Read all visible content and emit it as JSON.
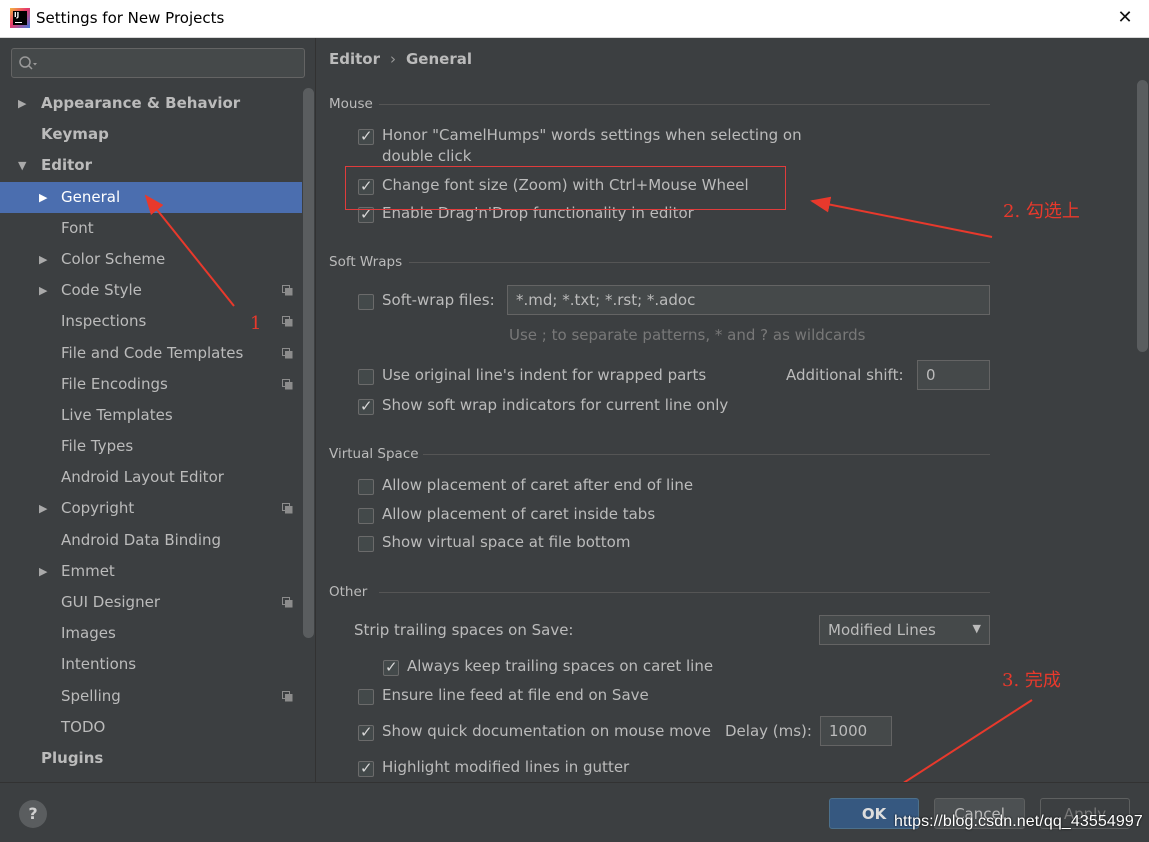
{
  "window": {
    "title": "Settings for New Projects",
    "close_glyph": "✕"
  },
  "sidebar": {
    "search_placeholder": "",
    "items": [
      {
        "label": "Appearance & Behavior",
        "level": 0,
        "arrow": "▶",
        "cfg": false
      },
      {
        "label": "Keymap",
        "level": 0,
        "arrow": "",
        "cfg": false
      },
      {
        "label": "Editor",
        "level": 0,
        "arrow": "▼",
        "cfg": false
      },
      {
        "label": "General",
        "level": 1,
        "arrow": "▶",
        "cfg": false,
        "selected": true
      },
      {
        "label": "Font",
        "level": 1,
        "arrow": "",
        "cfg": false
      },
      {
        "label": "Color Scheme",
        "level": 1,
        "arrow": "▶",
        "cfg": false
      },
      {
        "label": "Code Style",
        "level": 1,
        "arrow": "▶",
        "cfg": true
      },
      {
        "label": "Inspections",
        "level": 1,
        "arrow": "",
        "cfg": true
      },
      {
        "label": "File and Code Templates",
        "level": 1,
        "arrow": "",
        "cfg": true
      },
      {
        "label": "File Encodings",
        "level": 1,
        "arrow": "",
        "cfg": true
      },
      {
        "label": "Live Templates",
        "level": 1,
        "arrow": "",
        "cfg": false
      },
      {
        "label": "File Types",
        "level": 1,
        "arrow": "",
        "cfg": false
      },
      {
        "label": "Android Layout Editor",
        "level": 1,
        "arrow": "",
        "cfg": false
      },
      {
        "label": "Copyright",
        "level": 1,
        "arrow": "▶",
        "cfg": true
      },
      {
        "label": "Android Data Binding",
        "level": 1,
        "arrow": "",
        "cfg": false
      },
      {
        "label": "Emmet",
        "level": 1,
        "arrow": "▶",
        "cfg": false
      },
      {
        "label": "GUI Designer",
        "level": 1,
        "arrow": "",
        "cfg": true
      },
      {
        "label": "Images",
        "level": 1,
        "arrow": "",
        "cfg": false
      },
      {
        "label": "Intentions",
        "level": 1,
        "arrow": "",
        "cfg": false
      },
      {
        "label": "Spelling",
        "level": 1,
        "arrow": "",
        "cfg": true
      },
      {
        "label": "TODO",
        "level": 1,
        "arrow": "",
        "cfg": false
      },
      {
        "label": "Plugins",
        "level": 0,
        "arrow": "",
        "cfg": false
      }
    ]
  },
  "breadcrumb": {
    "parent": "Editor",
    "separator": "›",
    "current": "General"
  },
  "mouse": {
    "title": "Mouse",
    "camel_humps_line1": "Honor \"CamelHumps\" words settings when selecting on",
    "camel_humps_line2": "double click",
    "zoom": "Change font size (Zoom) with Ctrl+Mouse Wheel",
    "dragdrop": "Enable Drag'n'Drop functionality in editor"
  },
  "soft_wraps": {
    "title": "Soft Wraps",
    "files_label": "Soft-wrap files:",
    "files_value": "*.md; *.txt; *.rst; *.adoc",
    "hint": "Use ; to separate patterns, * and ? as wildcards",
    "original_indent": "Use original line's indent for wrapped parts",
    "additional_shift_label": "Additional shift:",
    "additional_shift_value": "0",
    "show_indicators": "Show soft wrap indicators for current line only"
  },
  "virtual_space": {
    "title": "Virtual Space",
    "after_eol": "Allow placement of caret after end of line",
    "inside_tabs": "Allow placement of caret inside tabs",
    "file_bottom": "Show virtual space at file bottom"
  },
  "other": {
    "title": "Other",
    "strip_label": "Strip trailing spaces on Save:",
    "strip_value": "Modified Lines",
    "keep_caret": "Always keep trailing spaces on caret line",
    "line_feed": "Ensure line feed at file end on Save",
    "quick_doc": "Show quick documentation on mouse move",
    "delay_label": "Delay (ms):",
    "delay_value": "1000",
    "highlight_modified": "Highlight modified lines in gutter"
  },
  "annotations": {
    "a1": "1",
    "a2": "2. 勾选上",
    "a3": "3. 完成",
    "color": "#e8392c"
  },
  "footer": {
    "help": "?",
    "ok": "OK",
    "cancel": "Cancel",
    "apply": "Apply",
    "watermark": "https://blog.csdn.net/qq_43554997"
  }
}
